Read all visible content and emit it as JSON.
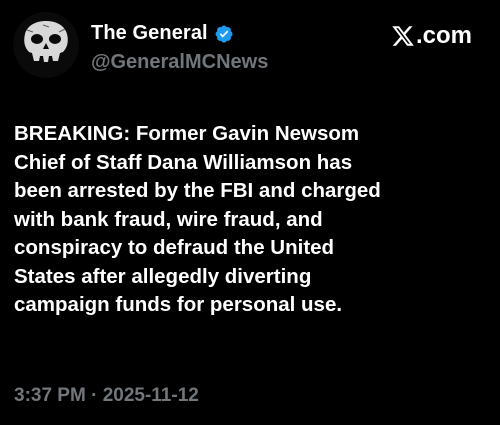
{
  "author": {
    "display_name": "The General",
    "handle": "@GeneralMCNews",
    "avatar_icon": "skull-avatar",
    "verified_icon": "verified-badge-icon",
    "verified_color": "#1d9bf0"
  },
  "brand": {
    "logo_icon": "x-logo-icon",
    "suffix": ".com"
  },
  "tweet": {
    "lines": [
      "BREAKING: Former Gavin Newsom",
      "Chief of Staff Dana Williamson has",
      "been arrested by the FBI and charged",
      "with bank fraud, wire fraud, and",
      "conspiracy to defraud the United",
      "States after allegedly diverting",
      "campaign funds for personal use."
    ],
    "timestamp": "3:37 PM · 2025-11-12"
  },
  "colors": {
    "background": "#000000",
    "primary_text": "#ffffff",
    "secondary_text": "#71767b"
  }
}
